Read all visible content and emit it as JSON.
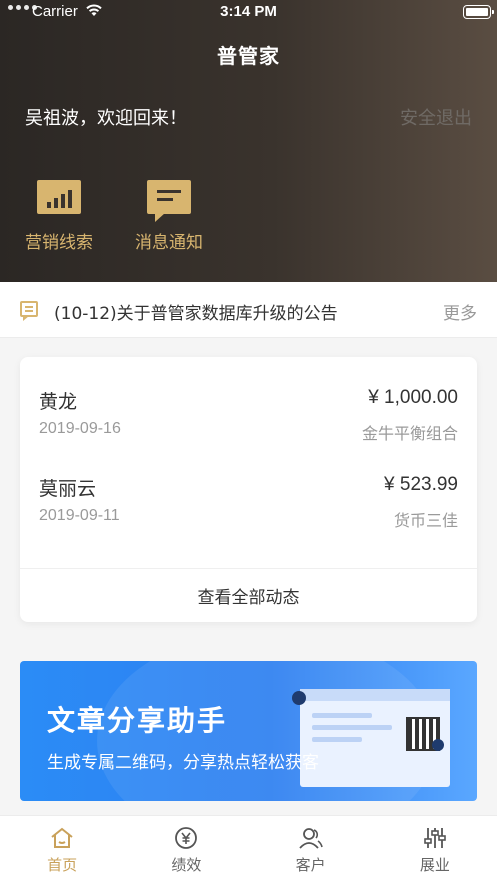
{
  "status_bar": {
    "carrier": "Carrier",
    "time": "3:14 PM"
  },
  "nav": {
    "title": "普管家"
  },
  "header": {
    "greeting": "吴祖波，欢迎回来！",
    "logout_label": "安全退出"
  },
  "quick_actions": [
    {
      "label": "营销线索",
      "icon": "bar-chart-icon"
    },
    {
      "label": "消息通知",
      "icon": "message-icon"
    }
  ],
  "notice": {
    "text": "(10-12)关于普管家数据库升级的公告",
    "more_label": "更多",
    "icon": "announcement-icon"
  },
  "activity": {
    "items": [
      {
        "name": "黄龙",
        "amount": "¥ 1,000.00",
        "date": "2019-09-16",
        "product": "金牛平衡组合"
      },
      {
        "name": "莫丽云",
        "amount": "¥ 523.99",
        "date": "2019-09-11",
        "product": "货币三佳"
      }
    ],
    "view_all_label": "查看全部动态"
  },
  "banner": {
    "title": "文章分享助手",
    "subtitle": "生成专属二维码，分享热点轻松获客"
  },
  "tabs": [
    {
      "label": "首页",
      "icon": "home-icon",
      "active": true
    },
    {
      "label": "绩效",
      "icon": "yen-circle-icon",
      "active": false
    },
    {
      "label": "客户",
      "icon": "customers-icon",
      "active": false
    },
    {
      "label": "展业",
      "icon": "sliders-icon",
      "active": false
    }
  ],
  "colors": {
    "accent_gold": "#d8b56f",
    "tab_active": "#c9a15a",
    "banner_blue": "#2b8cf6"
  }
}
